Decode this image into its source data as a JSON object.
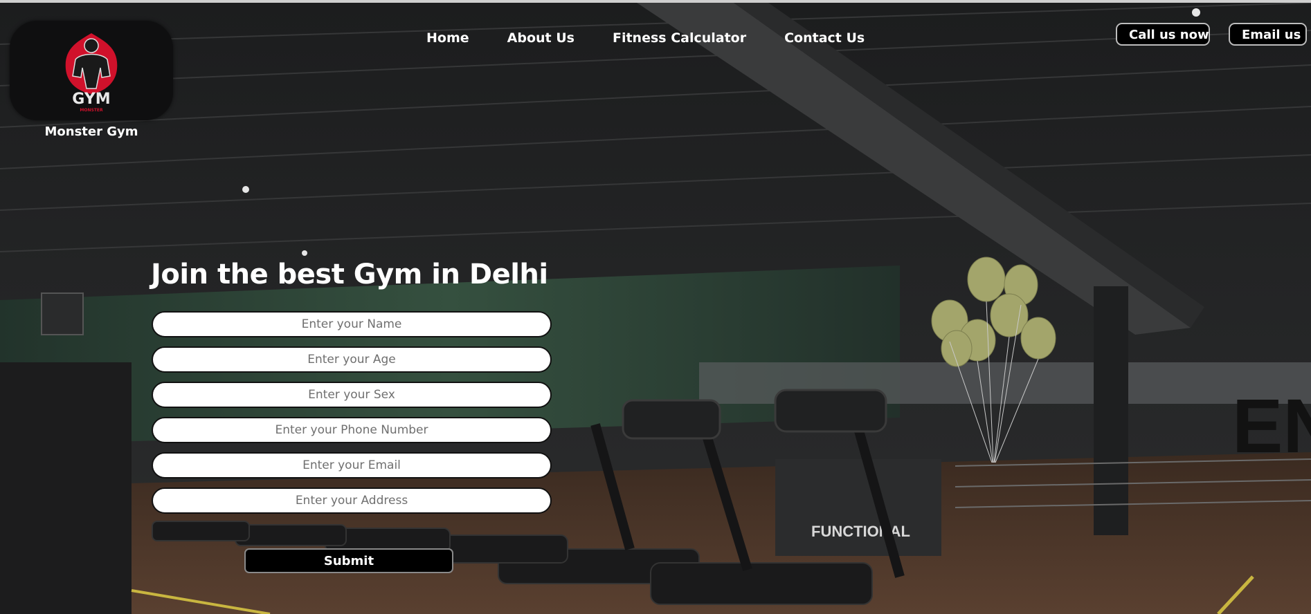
{
  "brand": {
    "name": "Monster Gym",
    "logo_text": "GYM",
    "logo_subtext": "MONSTER"
  },
  "nav": {
    "items": [
      {
        "label": "Home"
      },
      {
        "label": "About Us"
      },
      {
        "label": "Fitness Calculator"
      },
      {
        "label": "Contact Us"
      }
    ]
  },
  "contact": {
    "call_label": "Call us now",
    "email_label": "Email us"
  },
  "form": {
    "title": "Join the best Gym in Delhi",
    "fields": [
      {
        "placeholder": "Enter your Name"
      },
      {
        "placeholder": "Enter your Age"
      },
      {
        "placeholder": "Enter your Sex"
      },
      {
        "placeholder": "Enter your Phone Number"
      },
      {
        "placeholder": "Enter your Email"
      },
      {
        "placeholder": "Enter your Address"
      }
    ],
    "submit_label": "Submit"
  },
  "background": {
    "sign_text": "FUNCTIONAL",
    "colors": {
      "ceiling": "#2a2b2c",
      "floor": "#4a3528",
      "wall_green": "#2f4a3c",
      "balloon": "#a3a56b"
    }
  }
}
